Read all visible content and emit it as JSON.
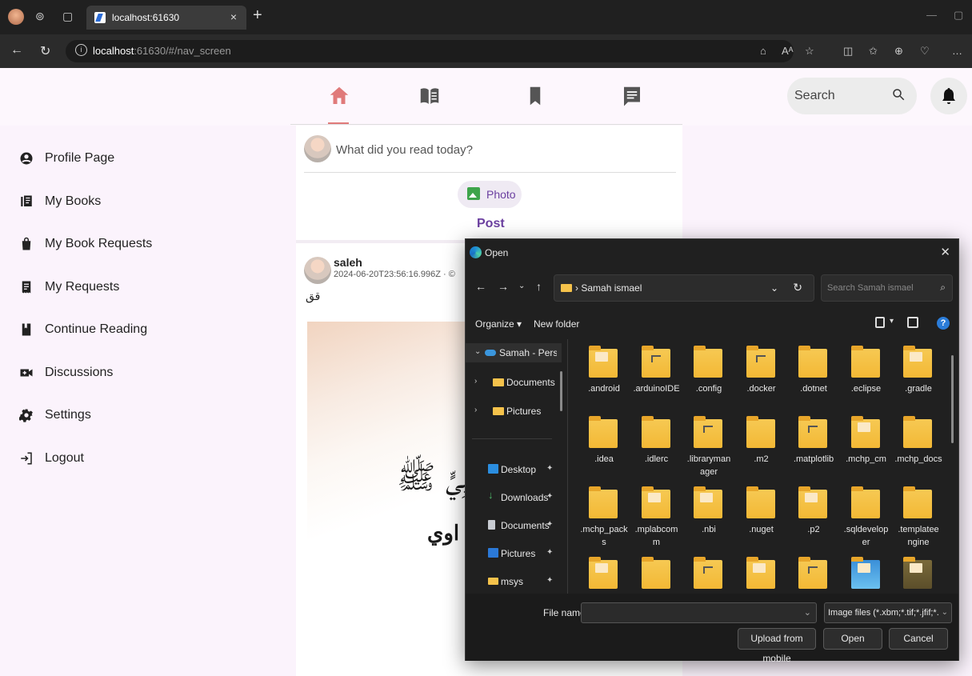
{
  "browser": {
    "tab_title": "localhost:61630",
    "url_host": "localhost",
    "url_rest": ":61630/#/nav_screen"
  },
  "app": {
    "search_placeholder": "Search",
    "sidebar": [
      {
        "label": "Profile Page",
        "icon": "profile-icon"
      },
      {
        "label": "My Books",
        "icon": "books-icon"
      },
      {
        "label": "My Book Requests",
        "icon": "shopping-bag-icon"
      },
      {
        "label": "My Requests",
        "icon": "receipt-icon"
      },
      {
        "label": "Continue Reading",
        "icon": "book-icon"
      },
      {
        "label": "Discussions",
        "icon": "video-call-icon"
      },
      {
        "label": "Settings",
        "icon": "gear-icon"
      },
      {
        "label": "Logout",
        "icon": "logout-icon"
      }
    ],
    "composer": {
      "prompt": "What did you read today?",
      "photo_label": "Photo",
      "post_label": "Post"
    },
    "post": {
      "user": "saleh",
      "date": "2024-06-20T23:56:16.996Z · ©",
      "text": "قق",
      "image_text_1": "نَبِيٍّ ﷺ",
      "image_text_2": "اوي"
    },
    "colors": {
      "accent": "#e07a7a",
      "purple": "#6b3fa0"
    }
  },
  "dialog": {
    "title": "Open",
    "path": "Samah ismael",
    "search_placeholder": "Search Samah ismael",
    "organize": "Organize ▾",
    "new_folder": "New folder",
    "tree_top": [
      {
        "label": "Samah - Persona",
        "kind": "cloud"
      },
      {
        "label": "Documents",
        "kind": "folder"
      },
      {
        "label": "Pictures",
        "kind": "folder"
      }
    ],
    "quick_access": [
      {
        "label": "Desktop",
        "icon": "desktop-icon"
      },
      {
        "label": "Downloads",
        "icon": "download-icon"
      },
      {
        "label": "Documents",
        "icon": "documents-icon"
      },
      {
        "label": "Pictures",
        "icon": "pictures-icon"
      },
      {
        "label": "msys",
        "icon": "folder-icon"
      }
    ],
    "files": [
      ".android",
      ".arduinoIDE",
      ".config",
      ".docker",
      ".dotnet",
      ".eclipse",
      ".gradle",
      ".idea",
      ".idlerc",
      ".libraryman ager",
      ".m2",
      ".matplotlib",
      ".mchp_cm",
      ".mchp_docs",
      ".mchp_pack s",
      ".mplabcom m",
      ".nbi",
      ".nuget",
      ".p2",
      ".sqldevelop er",
      ".templatee ngine",
      "",
      "",
      "",
      "",
      "",
      "",
      ""
    ],
    "file_name_label": "File name:",
    "file_name_value": "",
    "filter": "Image files (*.xbm;*.tif;*.jfif;*.ico",
    "upload_label": "Upload from mobile",
    "open_label": "Open",
    "cancel_label": "Cancel"
  }
}
